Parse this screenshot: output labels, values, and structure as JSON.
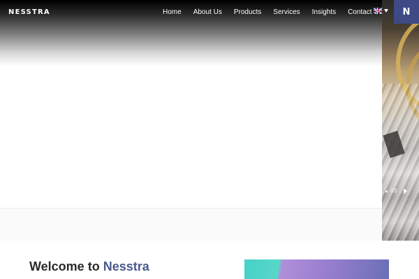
{
  "header": {
    "logo": "NESSTRA",
    "nav": [
      "Home",
      "About Us",
      "Products",
      "Services",
      "Insights",
      "Contact Us"
    ],
    "language": {
      "flag": "uk-flag-icon",
      "caret": "chevron-down-icon"
    },
    "badge": "N"
  },
  "hero": {
    "slide_number": "03",
    "next_icon": "chevron-right-icon"
  },
  "welcome": {
    "prefix": "Welcome to ",
    "brand": "Nesstra"
  },
  "colors": {
    "brand_navy": "#3d4a85",
    "brand_text": "#4a5a8c",
    "promo_teal": "#46d2c8",
    "promo_purple": "#9a7fd0"
  }
}
